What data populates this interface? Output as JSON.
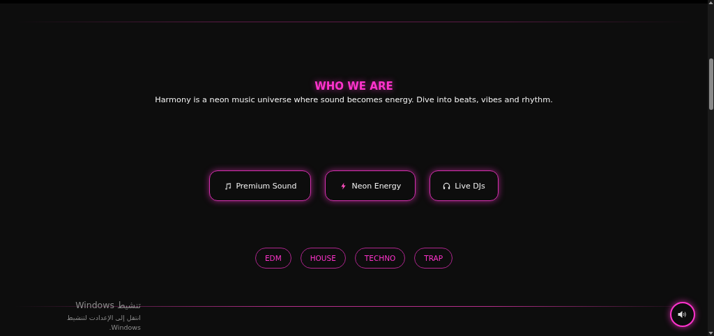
{
  "section": {
    "title": "WHO WE ARE",
    "description": "Harmony is a neon music universe where sound becomes energy. Dive into beats, vibes and rhythm."
  },
  "features": [
    {
      "label": "Premium Sound"
    },
    {
      "label": "Neon Energy"
    },
    {
      "label": "Live DJs"
    }
  ],
  "genres": [
    {
      "label": "EDM"
    },
    {
      "label": "HOUSE"
    },
    {
      "label": "TECHNO"
    },
    {
      "label": "TRAP"
    }
  ],
  "os_notice": {
    "title": "تنشيط Windows",
    "message": "انتقل إلى الإعدادت لتنشيط Windows."
  }
}
